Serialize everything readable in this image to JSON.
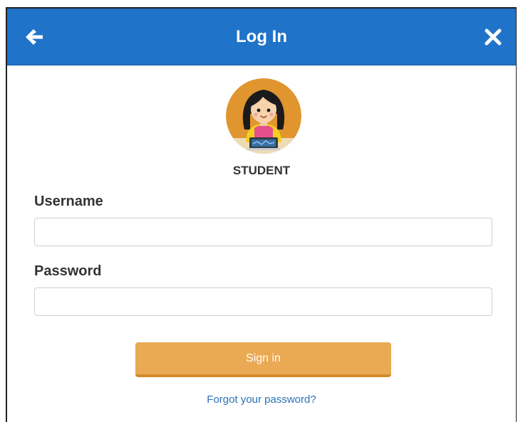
{
  "header": {
    "title": "Log In",
    "back_icon": "arrow-left-icon",
    "close_icon": "close-icon",
    "color": "#1f73c9"
  },
  "avatar": {
    "icon": "student-avatar-icon",
    "role_label": "STUDENT"
  },
  "form": {
    "username_label": "Username",
    "username_value": "",
    "password_label": "Password",
    "password_value": ""
  },
  "actions": {
    "sign_in_label": "Sign in",
    "sign_in_color": "#eaa953",
    "forgot_password_label": "Forgot your password?"
  }
}
